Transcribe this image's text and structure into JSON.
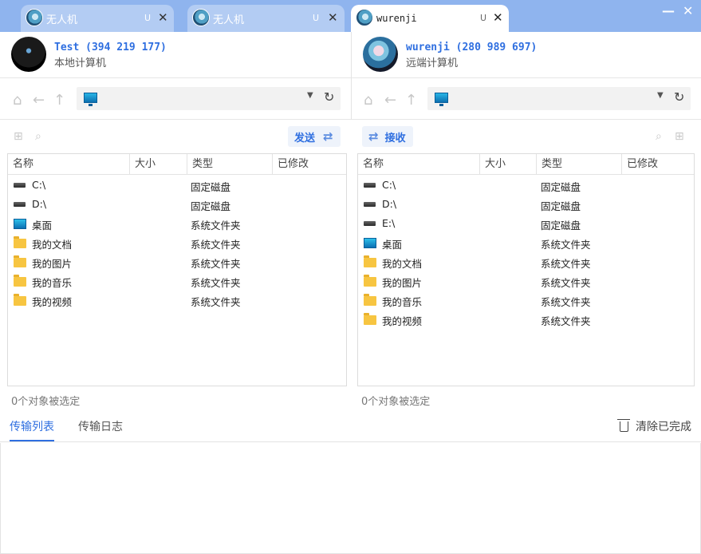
{
  "tabs": [
    {
      "title": "无人机",
      "lock": "U",
      "close": "✕",
      "active": false
    },
    {
      "title": "无人机",
      "lock": "U",
      "close": "✕",
      "active": false
    },
    {
      "title": "wurenji",
      "lock": "U",
      "close": "✕",
      "active": true
    }
  ],
  "window": {
    "minimize": "—",
    "close": "✕"
  },
  "local": {
    "name": "Test (394 219 177)",
    "subtitle": "本地计算机",
    "action_label": "发送",
    "status": "0个对象被选定",
    "columns": [
      "名称",
      "大小",
      "类型",
      "已修改"
    ],
    "files": [
      {
        "icon": "drive-icon",
        "name": "C:\\",
        "type": "固定磁盘"
      },
      {
        "icon": "drive-icon",
        "name": "D:\\",
        "type": "固定磁盘"
      },
      {
        "icon": "desktop-icon",
        "name": "桌面",
        "type": "系统文件夹"
      },
      {
        "icon": "folder-icon",
        "name": "我的文档",
        "type": "系统文件夹"
      },
      {
        "icon": "folder-icon",
        "name": "我的图片",
        "type": "系统文件夹"
      },
      {
        "icon": "folder-icon",
        "name": "我的音乐",
        "type": "系统文件夹"
      },
      {
        "icon": "folder-icon",
        "name": "我的视频",
        "type": "系统文件夹"
      }
    ]
  },
  "remote": {
    "name": "wurenji (280 989 697)",
    "subtitle": "远端计算机",
    "action_label": "接收",
    "status": "0个对象被选定",
    "columns": [
      "名称",
      "大小",
      "类型",
      "已修改"
    ],
    "files": [
      {
        "icon": "drive-icon",
        "name": "C:\\",
        "type": "固定磁盘"
      },
      {
        "icon": "drive-icon",
        "name": "D:\\",
        "type": "固定磁盘"
      },
      {
        "icon": "drive-icon",
        "name": "E:\\",
        "type": "固定磁盘"
      },
      {
        "icon": "desktop-icon",
        "name": "桌面",
        "type": "系统文件夹"
      },
      {
        "icon": "folder-icon",
        "name": "我的文档",
        "type": "系统文件夹"
      },
      {
        "icon": "folder-icon",
        "name": "我的图片",
        "type": "系统文件夹"
      },
      {
        "icon": "folder-icon",
        "name": "我的音乐",
        "type": "系统文件夹"
      },
      {
        "icon": "folder-icon",
        "name": "我的视频",
        "type": "系统文件夹"
      }
    ]
  },
  "bottom": {
    "tab_transfer": "传输列表",
    "tab_log": "传输日志",
    "clear_label": "清除已完成"
  },
  "colors": {
    "accent": "#2f6fe0",
    "tabbar": "#8fb4ee"
  }
}
